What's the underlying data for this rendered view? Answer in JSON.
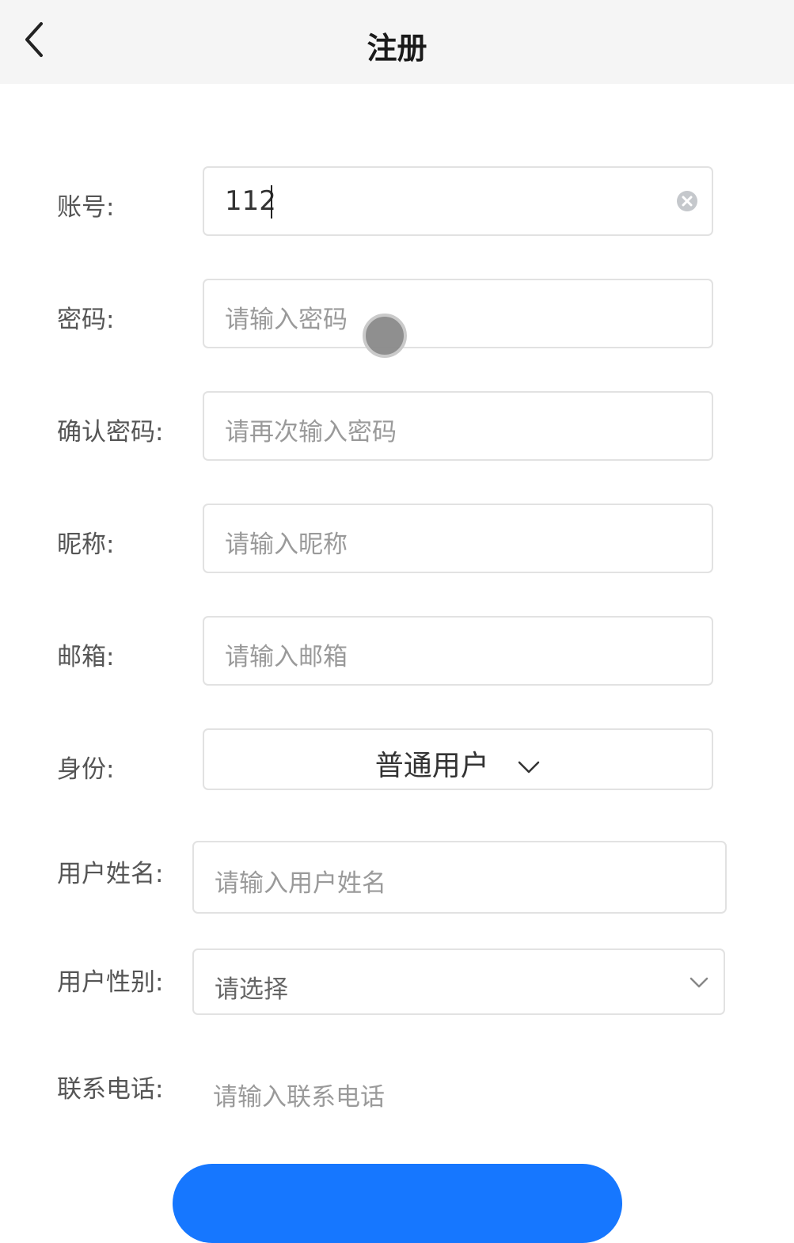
{
  "header": {
    "title": "注册",
    "back_icon": "chevron-left-icon"
  },
  "form": {
    "account": {
      "label": "账号:",
      "value": "112",
      "clear_icon": "clear-circle-icon"
    },
    "password": {
      "label": "密码:",
      "placeholder": "请输入密码"
    },
    "confirm_password": {
      "label": "确认密码:",
      "placeholder": "请再次输入密码"
    },
    "nickname": {
      "label": "昵称:",
      "placeholder": "请输入昵称"
    },
    "email": {
      "label": "邮箱:",
      "placeholder": "请输入邮箱"
    },
    "identity": {
      "label": "身份:",
      "selected": "普通用户",
      "icon": "chevron-down-icon"
    },
    "user_name": {
      "label": "用户姓名:",
      "placeholder": "请输入用户姓名"
    },
    "user_gender": {
      "label": "用户性别:",
      "placeholder": "请选择",
      "icon": "chevron-down-icon"
    },
    "phone": {
      "label": "联系电话:",
      "placeholder": "请输入联系电话"
    }
  },
  "submit": {
    "color": "#1677ff"
  },
  "colors": {
    "header_bg": "#f5f5f5",
    "label": "#555555",
    "placeholder": "#9a9a9a",
    "border": "#e2e2e2"
  }
}
